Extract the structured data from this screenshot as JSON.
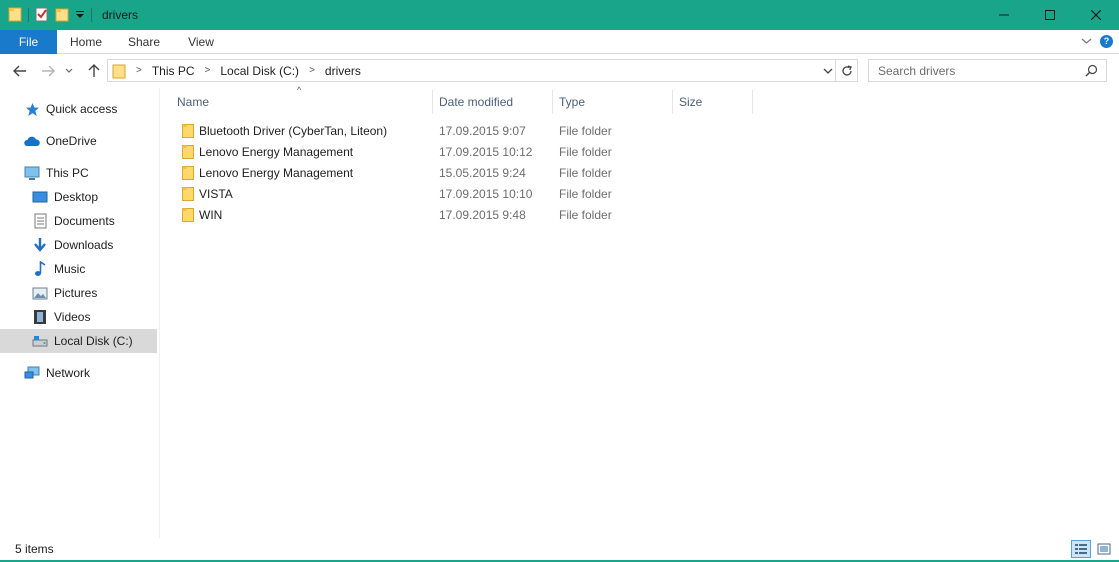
{
  "window": {
    "title": "drivers",
    "accent": "#18a58a"
  },
  "ribbon": {
    "tabs": [
      {
        "label": "File"
      },
      {
        "label": "Home"
      },
      {
        "label": "Share"
      },
      {
        "label": "View"
      }
    ],
    "help_label": "?"
  },
  "address": {
    "crumbs": [
      "This PC",
      "Local Disk (C:)",
      "drivers"
    ]
  },
  "search": {
    "placeholder": "Search drivers"
  },
  "sidebar": {
    "items": [
      {
        "label": "Quick access",
        "icon": "star-icon"
      },
      {
        "label": "OneDrive",
        "icon": "cloud-icon"
      },
      {
        "label": "This PC",
        "icon": "computer-icon"
      },
      {
        "label": "Desktop",
        "icon": "desktop-icon"
      },
      {
        "label": "Documents",
        "icon": "documents-icon"
      },
      {
        "label": "Downloads",
        "icon": "download-arrow-icon"
      },
      {
        "label": "Music",
        "icon": "music-note-icon"
      },
      {
        "label": "Pictures",
        "icon": "pictures-icon"
      },
      {
        "label": "Videos",
        "icon": "film-icon"
      },
      {
        "label": "Local Disk (C:)",
        "icon": "drive-icon",
        "selected": true
      },
      {
        "label": "Network",
        "icon": "network-icon"
      }
    ]
  },
  "columns": {
    "name": "Name",
    "date": "Date modified",
    "type": "Type",
    "size": "Size"
  },
  "files": [
    {
      "name": "Bluetooth Driver (CyberTan, Liteon)",
      "date": "17.09.2015 9:07",
      "type": "File folder"
    },
    {
      "name": "Lenovo Energy Management",
      "date": "17.09.2015 10:12",
      "type": "File folder"
    },
    {
      "name": "Lenovo Energy Management",
      "date": "15.05.2015 9:24",
      "type": "File folder"
    },
    {
      "name": "VISTA",
      "date": "17.09.2015 10:10",
      "type": "File folder"
    },
    {
      "name": "WIN",
      "date": "17.09.2015 9:48",
      "type": "File folder"
    }
  ],
  "status": {
    "item_count": "5 items"
  }
}
